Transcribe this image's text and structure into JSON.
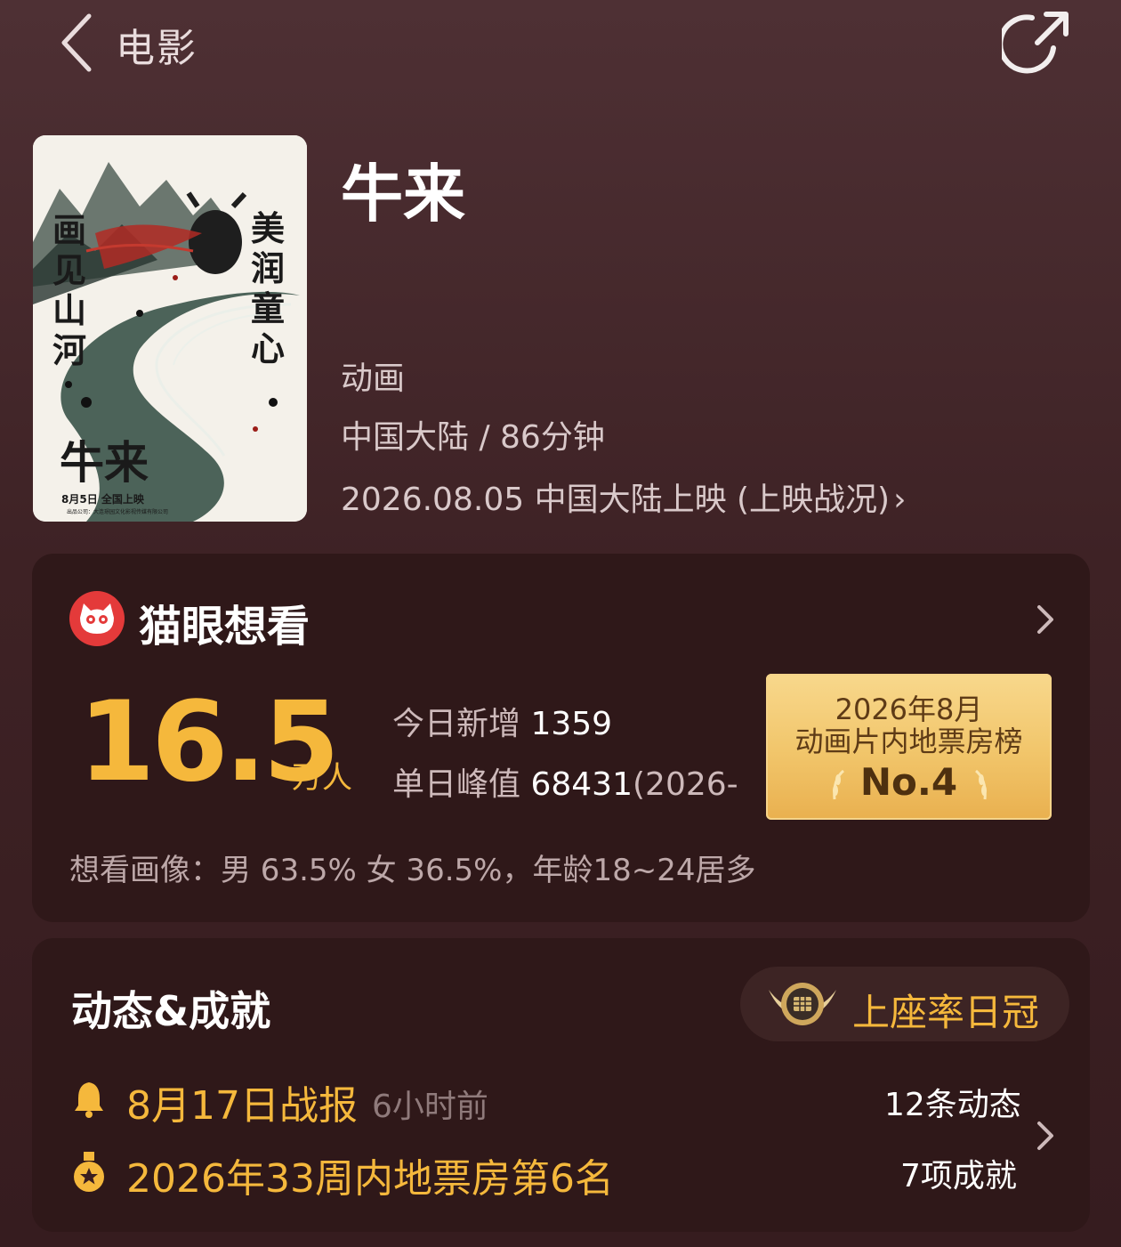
{
  "header": {
    "title": "电影",
    "back_icon": "chevron-left-icon",
    "share_icon": "share-icon"
  },
  "movie": {
    "title": "牛来",
    "genre": "动画",
    "region_duration": "中国大陆 / 86分钟",
    "release": "2026.08.05 中国大陆上映 (上映战况)",
    "poster": {
      "left_text": "画见山河",
      "right_text": "美润童心",
      "title_text": "牛来",
      "date_text": "8月5日 全国上映",
      "credit_text": "出品公司：大连璟园文化影视传媒有限公司"
    }
  },
  "want": {
    "title": "猫眼想看",
    "number": "16.5",
    "unit": "万人",
    "today_label": "今日新增",
    "today_value": "1359",
    "peak_label": "单日峰值",
    "peak_value": "68431",
    "peak_suffix": "(2026-",
    "rank_line1": "2026年8月",
    "rank_line2": "动画片内地票房榜",
    "rank_no": "No.4",
    "portrait": "想看画像：男 63.5% 女 36.5%，年龄18~24居多"
  },
  "dynamics": {
    "title": "动态&成就",
    "award": "上座率日冠",
    "report_title": "8月17日战报",
    "report_time": "6小时前",
    "dyn_count": "12条动态",
    "achievement_title": "2026年33周内地票房第6名",
    "achievement_count": "7项成就"
  },
  "colors": {
    "background": "#3e2225",
    "card": "#2f1819",
    "accent_gold": "#f5b83c",
    "badge_gold": "#f1c56a"
  }
}
